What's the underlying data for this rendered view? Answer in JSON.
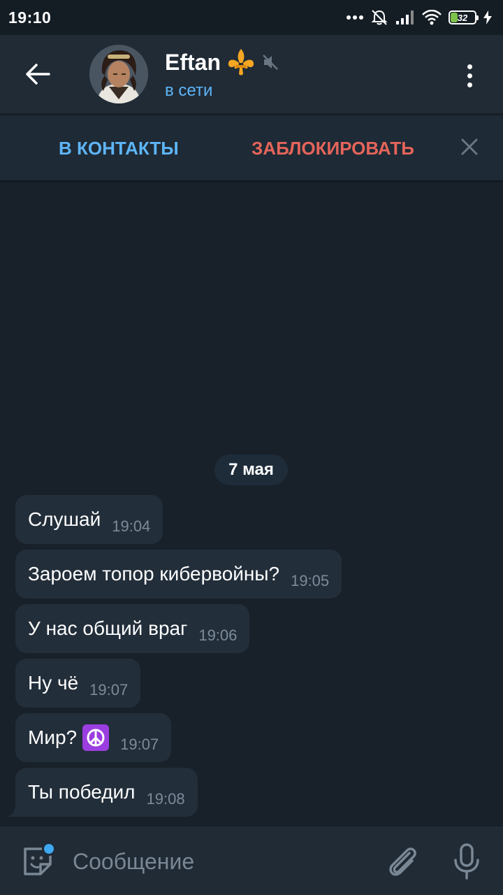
{
  "status_bar": {
    "time": "19:10",
    "battery_level": "32",
    "battery_fraction": 0.32,
    "icons": [
      "more-dots-icon",
      "alarm-off-icon",
      "signal-icon",
      "wifi-icon",
      "battery-icon",
      "charging-icon"
    ]
  },
  "header": {
    "contact_name": "Eftan",
    "name_badge_icon": "fleur-de-lis-icon",
    "muted_icon": "muted-speaker-icon",
    "status": "в сети"
  },
  "action_bar": {
    "add_contact_label": "В КОНТАКТЫ",
    "block_label": "ЗАБЛОКИРОВАТЬ"
  },
  "date_separator": "7 мая",
  "messages": [
    {
      "text": "Слушай",
      "time": "19:04"
    },
    {
      "text": "Зароем топор кибервойны?",
      "time": "19:05"
    },
    {
      "text": "У нас общий враг",
      "time": "19:06"
    },
    {
      "text": "Ну чё",
      "time": "19:07"
    },
    {
      "text": "Мир?",
      "emoji": "peace-symbol-emoji",
      "time": "19:07"
    },
    {
      "text": "Ты победил",
      "time": "19:08"
    }
  ],
  "input_bar": {
    "placeholder": "Сообщение"
  },
  "colors": {
    "background": "#182029",
    "header": "#202b36",
    "bubble": "#222e3a",
    "accent_blue": "#5eb5f7",
    "block_red": "#e5645a"
  }
}
